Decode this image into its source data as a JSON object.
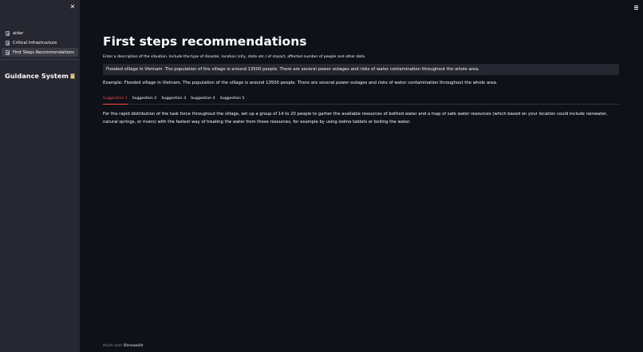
{
  "sidebar": {
    "close_glyph": "✕",
    "nav_items": [
      {
        "label": "aidar",
        "icon": "document-icon"
      },
      {
        "label": "Critical Infrastructure",
        "icon": "document-icon"
      },
      {
        "label": "First Steps Recommendations",
        "icon": "document-icon",
        "active": true
      }
    ],
    "title": "Guidance System",
    "title_icon": "clipboard-icon"
  },
  "header": {
    "menu_icon": "hamburger-menu-icon"
  },
  "main": {
    "title": "First steps recommendations",
    "input_label": "Enter a description of the situation. Include the type of disaster, location (city, state etc.) of impact, affected number of people and other data.",
    "input_value": "Flooded village in Vietnam. The population of the village is around 13500 people. There are several power outages and risks of water contamination throughout the whole area.",
    "example": "Example: Flooded village in Vietnam. The population of the village is around 13500 people. There are several power outages and risks of water contamination throughout the whole area.",
    "tabs": [
      "Suggestion 1",
      "Suggestion 2",
      "Suggestion 3",
      "Suggestion 4",
      "Suggestion 5"
    ],
    "active_tab": "Suggestion 1",
    "suggestion_text": "For the rapid distribution of the task force throughout the village, set up a group of 14 to 20 people to gather the available resources of bottled water and a map of safe water resources (which based on your location could include rainwater, natural springs, or rivers) with the fastest way of treating the water from those resources, for example by using iodine tablets or boiling the water."
  },
  "footer": {
    "prefix": "Made with",
    "brand": "Streamlit"
  },
  "colors": {
    "background": "#0e1117",
    "sidebar": "#262730",
    "accent": "#ff4b4b",
    "text": "#fafafa"
  }
}
